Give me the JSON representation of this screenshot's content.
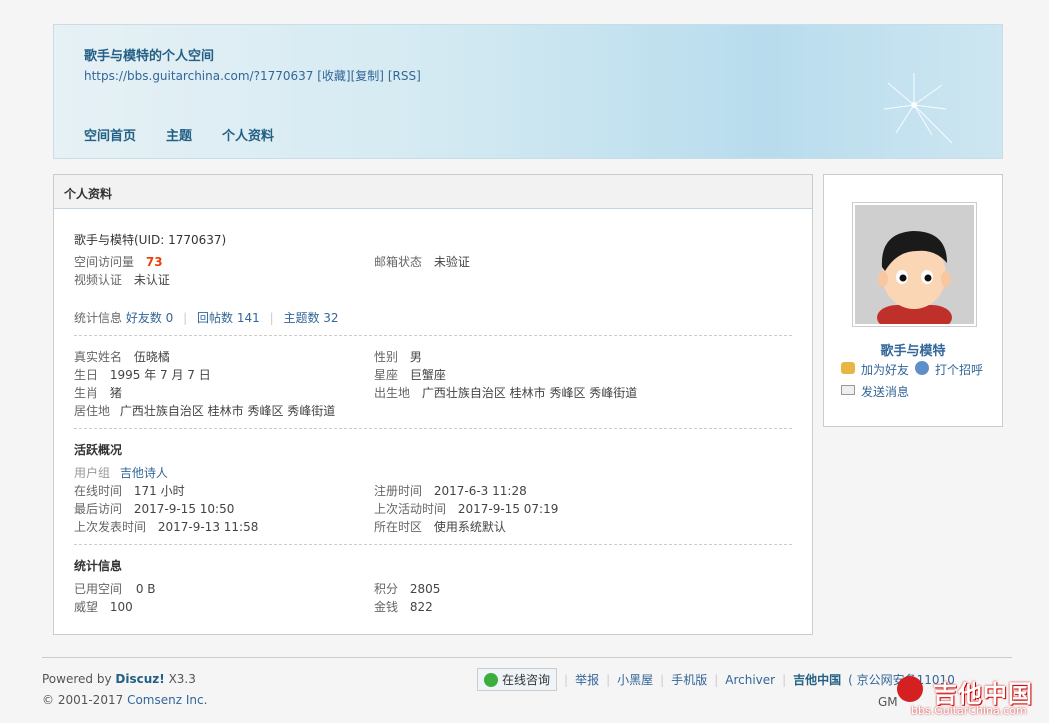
{
  "header": {
    "title": "歌手与模特的个人空间",
    "url": "https://bbs.guitarchina.com/?1770637",
    "links": [
      "[收藏]",
      "[复制]",
      "[RSS]"
    ],
    "nav": [
      "空间首页",
      "主题",
      "个人资料"
    ]
  },
  "panel": {
    "heading": "个人资料",
    "user_line": "歌手与模特(UID: 1770637)",
    "visits_label": "空间访问量",
    "visits_value": "73",
    "email_label": "邮箱状态",
    "email_value": "未验证",
    "video_label": "视频认证",
    "video_value": "未认证",
    "stats_label": "统计信息",
    "stats_friends": "好友数 0",
    "stats_replies": "回帖数 141",
    "stats_threads": "主题数 32",
    "realname_label": "真实姓名",
    "realname_value": "伍晓橘",
    "gender_label": "性别",
    "gender_value": "男",
    "birthday_label": "生日",
    "birthday_value": "1995 年 7 月 7 日",
    "zodiac_label": "星座",
    "zodiac_value": "巨蟹座",
    "chinese_zodiac_label": "生肖",
    "chinese_zodiac_value": "猪",
    "birthplace_label": "出生地",
    "birthplace_value": "广西壮族自治区 桂林市 秀峰区 秀峰街道",
    "residence_label": "居住地",
    "residence_value": "广西壮族自治区 桂林市 秀峰区 秀峰街道",
    "activity_title": "活跃概况",
    "group_label": "用户组",
    "group_value": "吉他诗人",
    "online_label": "在线时间",
    "online_value": "171 小时",
    "reg_label": "注册时间",
    "reg_value": "2017-6-3 11:28",
    "lastvisit_label": "最后访问",
    "lastvisit_value": "2017-9-15 10:50",
    "lastactive_label": "上次活动时间",
    "lastactive_value": "2017-9-15 07:19",
    "lastpost_label": "上次发表时间",
    "lastpost_value": "2017-9-13 11:58",
    "tz_label": "所在时区",
    "tz_value": "使用系统默认",
    "stats_title": "统计信息",
    "space_label": "已用空间",
    "space_value": "0 B",
    "credits_label": "积分",
    "credits_value": "2805",
    "prestige_label": "威望",
    "prestige_value": "100",
    "money_label": "金钱",
    "money_value": "822"
  },
  "side": {
    "username": "歌手与模特",
    "add_friend": "加为好友",
    "greet": "打个招呼",
    "message": "发送消息"
  },
  "footer": {
    "powered": "Powered by",
    "brand": "Discuz!",
    "version": "X3.3",
    "copyright": "© 2001-2017",
    "company": "Comsenz Inc.",
    "consult": "在线咨询",
    "links": [
      "举报",
      "小黑屋",
      "手机版",
      "Archiver"
    ],
    "site": "吉他中国",
    "icp": "( 京公网安备11010",
    "gmt": "GM",
    "watermark": "吉他中国",
    "watermark_url": "bbs.GuitarChina.com"
  },
  "colors": {
    "accent": "#336699",
    "visits": "#e9410c",
    "header_title": "#245f85"
  }
}
